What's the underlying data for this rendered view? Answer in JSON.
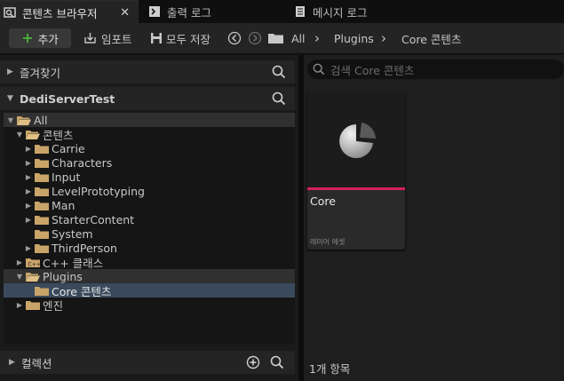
{
  "tabs": [
    {
      "label": "콘텐츠 브라우저",
      "icon": "content-browser-icon",
      "active": true,
      "close": "✕"
    },
    {
      "label": "출력 로그",
      "icon": "terminal-icon",
      "active": false
    },
    {
      "label": "메시지 로그",
      "icon": "message-log-icon",
      "active": false
    }
  ],
  "toolbar": {
    "add_label": "추가",
    "import_label": "임포트",
    "save_all_label": "모두 저장",
    "breadcrumb": [
      "All",
      "Plugins",
      "Core 콘텐츠"
    ],
    "separator": "›"
  },
  "left": {
    "favorites": {
      "label": "즐겨찾기"
    },
    "project": {
      "label": "DediServerTest"
    },
    "tree": [
      {
        "label": "All",
        "depth": 0,
        "expanded": true,
        "twisty": "▼",
        "open": true,
        "style": "hl"
      },
      {
        "label": "콘텐츠",
        "depth": 1,
        "expanded": true,
        "twisty": "▼",
        "open": true
      },
      {
        "label": "Carrie",
        "depth": 2,
        "twisty": "▶"
      },
      {
        "label": "Characters",
        "depth": 2,
        "twisty": "▶"
      },
      {
        "label": "Input",
        "depth": 2,
        "twisty": "▶"
      },
      {
        "label": "LevelPrototyping",
        "depth": 2,
        "twisty": "▶"
      },
      {
        "label": "Man",
        "depth": 2,
        "twisty": "▶"
      },
      {
        "label": "StarterContent",
        "depth": 2,
        "twisty": "▶"
      },
      {
        "label": "System",
        "depth": 2,
        "twisty": ""
      },
      {
        "label": "ThirdPerson",
        "depth": 2,
        "twisty": "▶"
      },
      {
        "label": "C++ 클래스",
        "depth": 1,
        "twisty": "▶",
        "cpp": true
      },
      {
        "label": "Plugins",
        "depth": 1,
        "expanded": true,
        "twisty": "▼",
        "open": true,
        "style": "hl"
      },
      {
        "label": "Core 콘텐츠",
        "depth": 2,
        "twisty": "",
        "style": "sel"
      },
      {
        "label": "엔진",
        "depth": 1,
        "twisty": "▶"
      }
    ],
    "collection": {
      "label": "컬렉션"
    }
  },
  "right": {
    "search_placeholder": "검색 Core 콘텐츠",
    "asset": {
      "name": "Core",
      "type": "레미어 에셋"
    },
    "count": "1개 항목"
  },
  "colors": {
    "folder": "#c9a468",
    "accent": "#d5205a",
    "add_green": "#4caf3c",
    "selection": "#3a4a5c"
  }
}
